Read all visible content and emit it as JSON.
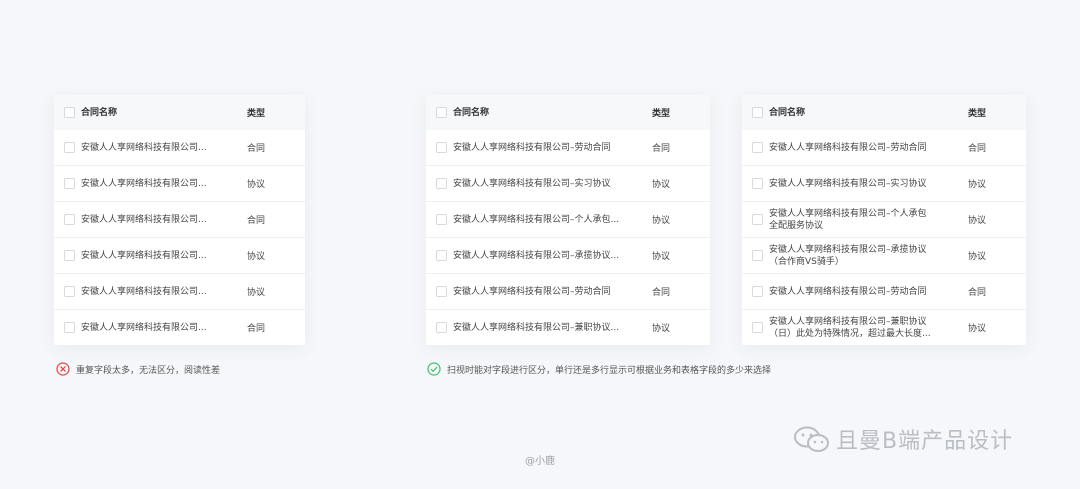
{
  "tables": [
    {
      "header": {
        "name": "合同名称",
        "type": "类型"
      },
      "rows": [
        {
          "name": "安徽人人享网络科技有限公司...",
          "type": "合同"
        },
        {
          "name": "安徽人人享网络科技有限公司...",
          "type": "协议"
        },
        {
          "name": "安徽人人享网络科技有限公司...",
          "type": "合同"
        },
        {
          "name": "安徽人人享网络科技有限公司...",
          "type": "协议"
        },
        {
          "name": "安徽人人享网络科技有限公司...",
          "type": "协议"
        },
        {
          "name": "安徽人人享网络科技有限公司...",
          "type": "合同"
        }
      ]
    },
    {
      "header": {
        "name": "合同名称",
        "type": "类型"
      },
      "rows": [
        {
          "name": "安徽人人享网络科技有限公司–劳动合同",
          "type": "合同"
        },
        {
          "name": "安徽人人享网络科技有限公司–实习协议",
          "type": "协议"
        },
        {
          "name": "安徽人人享网络科技有限公司–个人承包...",
          "type": "协议"
        },
        {
          "name": "安徽人人享网络科技有限公司–承揽协议...",
          "type": "协议"
        },
        {
          "name": "安徽人人享网络科技有限公司–劳动合同",
          "type": "合同"
        },
        {
          "name": "安徽人人享网络科技有限公司–兼职协议...",
          "type": "协议"
        }
      ]
    },
    {
      "header": {
        "name": "合同名称",
        "type": "类型"
      },
      "rows": [
        {
          "name": "安徽人人享网络科技有限公司–劳动合同",
          "type": "合同"
        },
        {
          "name": "安徽人人享网络科技有限公司–实习协议",
          "type": "协议"
        },
        {
          "name": "安徽人人享网络科技有限公司–个人承包\n全配服务协议",
          "type": "协议"
        },
        {
          "name": "安徽人人享网络科技有限公司–承揽协议\n（合作商VS骑手）",
          "type": "协议"
        },
        {
          "name": "安徽人人享网络科技有限公司–劳动合同",
          "type": "合同"
        },
        {
          "name": "安徽人人享网络科技有限公司–兼职协议\n（日）此处为特殊情况，超过最大长度...",
          "type": "协议"
        }
      ]
    }
  ],
  "notes": {
    "bad": "重复字段太多，无法区分，阅读性差",
    "good": "扫视时能对字段进行区分，单行还是多行显示可根据业务和表格字段的多少来选择",
    "bad_color": "#e8423f",
    "good_color": "#3cc26b"
  },
  "credit": "@小鹿",
  "brand": "且曼B端产品设计"
}
